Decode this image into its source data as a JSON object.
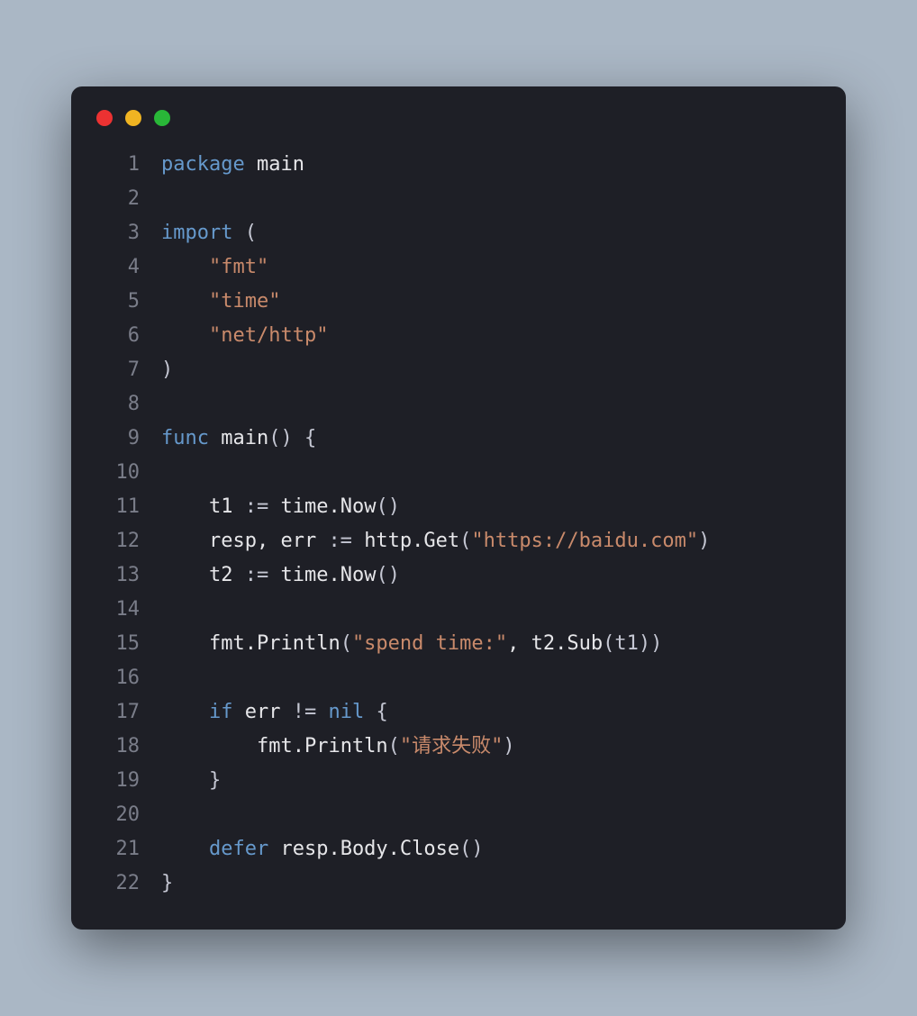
{
  "lines": [
    {
      "n": "1",
      "tokens": [
        {
          "t": "package ",
          "c": "kw"
        },
        {
          "t": "main",
          "c": "fn"
        }
      ]
    },
    {
      "n": "2",
      "tokens": []
    },
    {
      "n": "3",
      "tokens": [
        {
          "t": "import ",
          "c": "kw"
        },
        {
          "t": "(",
          "c": "punct"
        }
      ]
    },
    {
      "n": "4",
      "tokens": [
        {
          "t": "    ",
          "c": "fn"
        },
        {
          "t": "\"fmt\"",
          "c": "str"
        }
      ]
    },
    {
      "n": "5",
      "tokens": [
        {
          "t": "    ",
          "c": "fn"
        },
        {
          "t": "\"time\"",
          "c": "str"
        }
      ]
    },
    {
      "n": "6",
      "tokens": [
        {
          "t": "    ",
          "c": "fn"
        },
        {
          "t": "\"net/http\"",
          "c": "str"
        }
      ]
    },
    {
      "n": "7",
      "tokens": [
        {
          "t": ")",
          "c": "punct"
        }
      ]
    },
    {
      "n": "8",
      "tokens": []
    },
    {
      "n": "9",
      "tokens": [
        {
          "t": "func ",
          "c": "kw"
        },
        {
          "t": "main",
          "c": "fn"
        },
        {
          "t": "() {",
          "c": "punct"
        }
      ]
    },
    {
      "n": "10",
      "tokens": []
    },
    {
      "n": "11",
      "tokens": [
        {
          "t": "    t1 ",
          "c": "fn"
        },
        {
          "t": ":= ",
          "c": "op"
        },
        {
          "t": "time.",
          "c": "fn"
        },
        {
          "t": "Now",
          "c": "fn"
        },
        {
          "t": "()",
          "c": "punct"
        }
      ]
    },
    {
      "n": "12",
      "tokens": [
        {
          "t": "    resp, err ",
          "c": "fn"
        },
        {
          "t": ":= ",
          "c": "op"
        },
        {
          "t": "http.",
          "c": "fn"
        },
        {
          "t": "Get",
          "c": "fn"
        },
        {
          "t": "(",
          "c": "punct"
        },
        {
          "t": "\"https://baidu.com\"",
          "c": "str"
        },
        {
          "t": ")",
          "c": "punct"
        }
      ]
    },
    {
      "n": "13",
      "tokens": [
        {
          "t": "    t2 ",
          "c": "fn"
        },
        {
          "t": ":= ",
          "c": "op"
        },
        {
          "t": "time.",
          "c": "fn"
        },
        {
          "t": "Now",
          "c": "fn"
        },
        {
          "t": "()",
          "c": "punct"
        }
      ]
    },
    {
      "n": "14",
      "tokens": []
    },
    {
      "n": "15",
      "tokens": [
        {
          "t": "    fmt.",
          "c": "fn"
        },
        {
          "t": "Println",
          "c": "fn"
        },
        {
          "t": "(",
          "c": "punct"
        },
        {
          "t": "\"spend time:\"",
          "c": "str"
        },
        {
          "t": ", t2.",
          "c": "fn"
        },
        {
          "t": "Sub",
          "c": "fn"
        },
        {
          "t": "(t1))",
          "c": "punct"
        }
      ]
    },
    {
      "n": "16",
      "tokens": []
    },
    {
      "n": "17",
      "tokens": [
        {
          "t": "    ",
          "c": "fn"
        },
        {
          "t": "if ",
          "c": "kw"
        },
        {
          "t": "err ",
          "c": "fn"
        },
        {
          "t": "!= ",
          "c": "op"
        },
        {
          "t": "nil",
          "c": "nil"
        },
        {
          "t": " {",
          "c": "punct"
        }
      ]
    },
    {
      "n": "18",
      "tokens": [
        {
          "t": "        fmt.",
          "c": "fn"
        },
        {
          "t": "Println",
          "c": "fn"
        },
        {
          "t": "(",
          "c": "punct"
        },
        {
          "t": "\"请求失败\"",
          "c": "str"
        },
        {
          "t": ")",
          "c": "punct"
        }
      ]
    },
    {
      "n": "19",
      "tokens": [
        {
          "t": "    }",
          "c": "punct"
        }
      ]
    },
    {
      "n": "20",
      "tokens": []
    },
    {
      "n": "21",
      "tokens": [
        {
          "t": "    ",
          "c": "fn"
        },
        {
          "t": "defer ",
          "c": "kw"
        },
        {
          "t": "resp.Body.",
          "c": "fn"
        },
        {
          "t": "Close",
          "c": "fn"
        },
        {
          "t": "()",
          "c": "punct"
        }
      ]
    },
    {
      "n": "22",
      "tokens": [
        {
          "t": "}",
          "c": "punct"
        }
      ]
    }
  ]
}
